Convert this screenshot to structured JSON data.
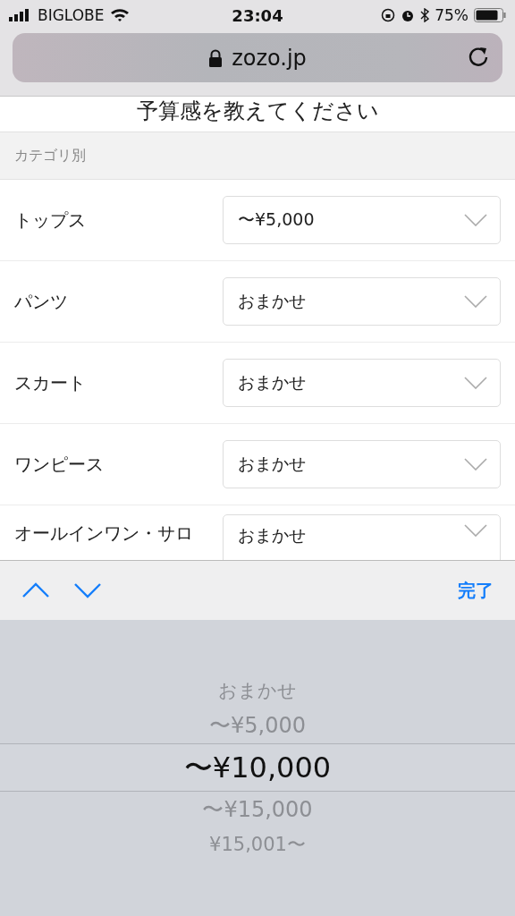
{
  "status_bar": {
    "carrier": "BIGLOBE",
    "time": "23:04",
    "battery": "75%"
  },
  "address_bar": {
    "url": "zozo.jp"
  },
  "heading": "予算感を教えてください",
  "section": "カテゴリ別",
  "rows": [
    {
      "label": "トップス",
      "value": "〜¥5,000"
    },
    {
      "label": "パンツ",
      "value": "おまかせ"
    },
    {
      "label": "スカート",
      "value": "おまかせ"
    },
    {
      "label": "ワンピース",
      "value": "おまかせ"
    },
    {
      "label": "オールインワン・サロ",
      "value": "おまかせ"
    }
  ],
  "toolbar": {
    "done": "完了"
  },
  "picker": [
    {
      "label": "おまかせ",
      "selected": false
    },
    {
      "label": "〜¥5,000",
      "selected": false
    },
    {
      "label": "〜¥10,000",
      "selected": true
    },
    {
      "label": "〜¥15,000",
      "selected": false
    },
    {
      "label": "¥15,001〜",
      "selected": false
    }
  ]
}
